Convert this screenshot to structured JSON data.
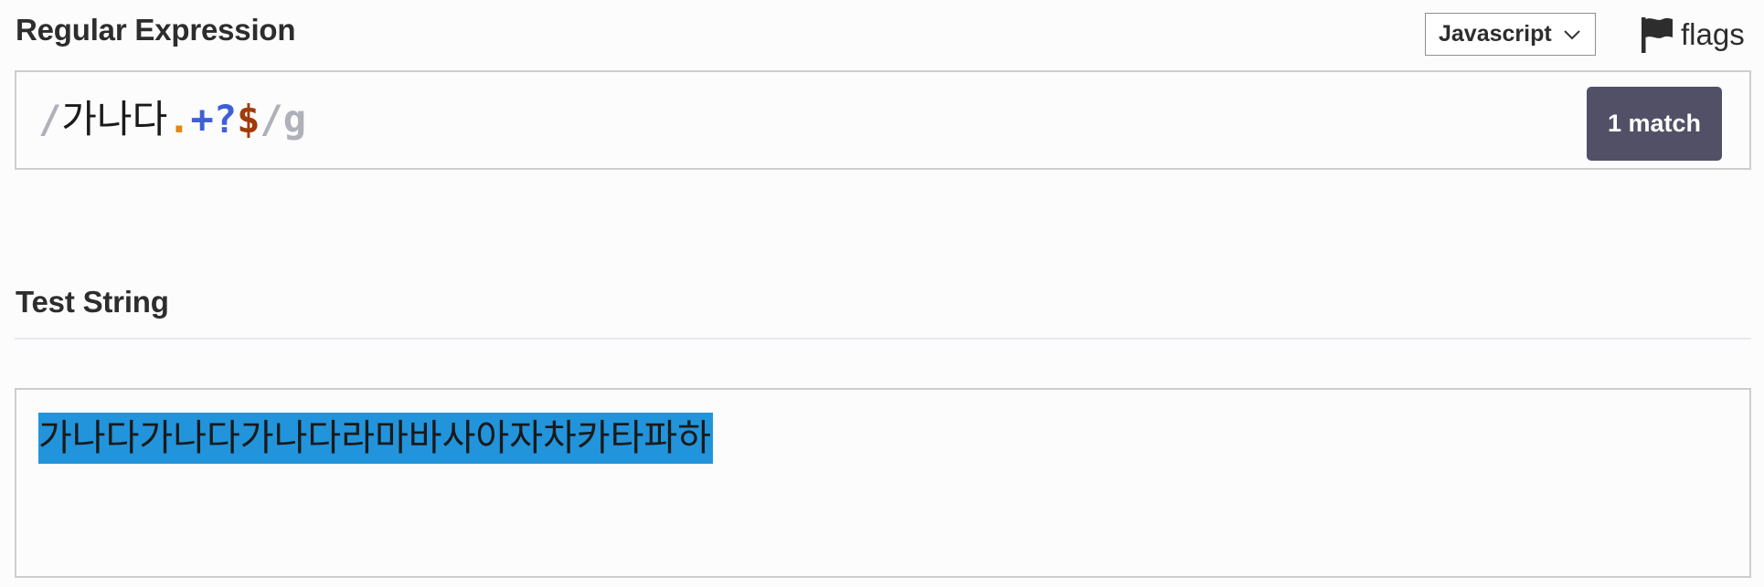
{
  "regex_section": {
    "title": "Regular Expression",
    "flavor": "Javascript",
    "flags_label": "flags",
    "pattern": {
      "open_delim": "/",
      "literal": "가나다",
      "dot": ".",
      "quantifier": "+?",
      "anchor": "$",
      "close_delim": "/",
      "flags": "g"
    },
    "match_count": "1 match"
  },
  "test_section": {
    "title": "Test String",
    "text": "가나다가나다가나다라마바사아자차카타파하"
  },
  "colors": {
    "match_highlight": "#2294db",
    "match_badge": "#515066",
    "dot_token": "#e8870f",
    "quantifier_token": "#3f5fd8",
    "anchor_token": "#a23a0a"
  },
  "icons": {
    "flavor_select": "chevron-down-icon",
    "flags": "flag-icon"
  }
}
